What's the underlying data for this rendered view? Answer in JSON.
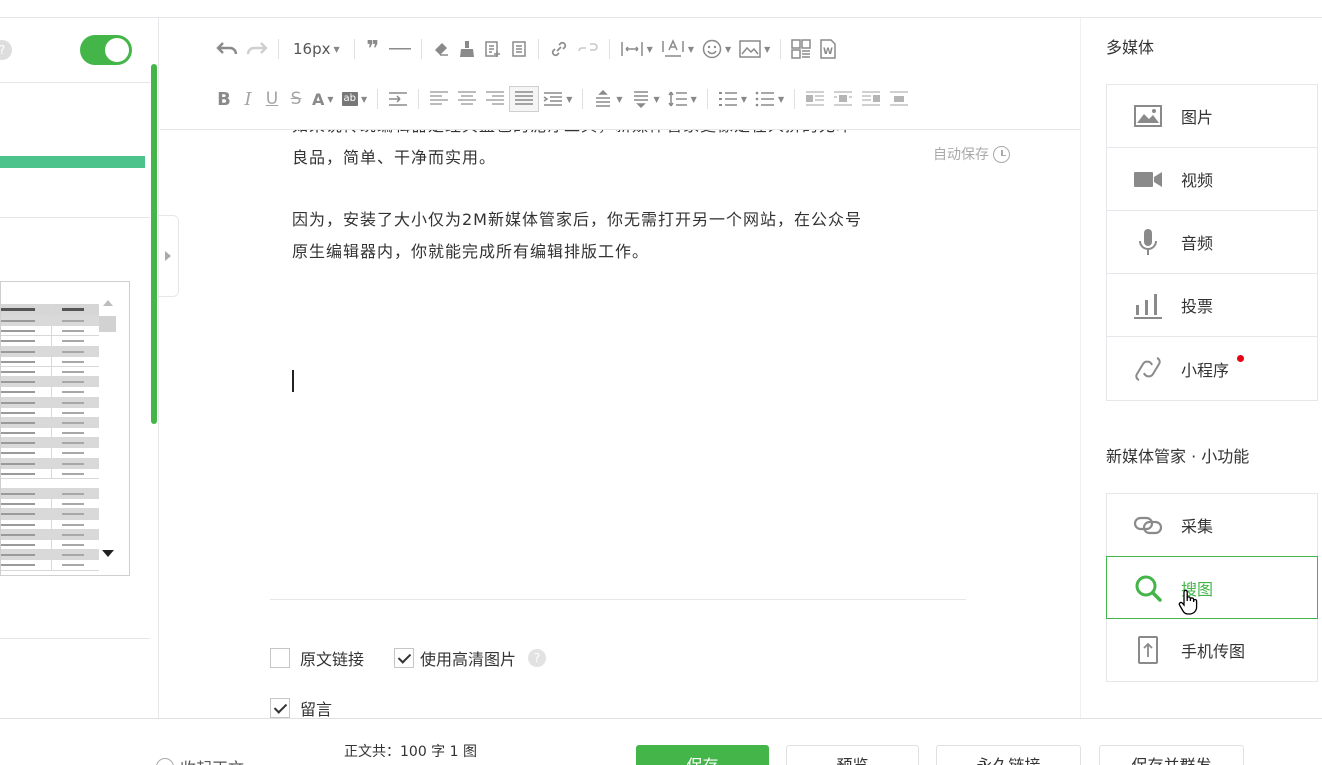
{
  "left": {
    "help": "?"
  },
  "toolbar": {
    "font_size": "16px"
  },
  "editor": {
    "autosave": "自动保存",
    "paragraphs": [
      "良品，简单、干净而实用。",
      "因为，安装了大小仅为2M新媒体管家后，你无需打开另一个网站，在公众号原生编辑器内，你就能完成所有编辑排版工作。"
    ],
    "paragraph2_line1": "因为，安装了大小仅为2M新媒体管家后，你无需打开另一个网站，在公众号",
    "paragraph2_line2": "原生编辑器内，你就能完成所有编辑排版工作。",
    "options": {
      "original_link": "原文链接",
      "hd_images": "使用高清图片",
      "hd_help": "?",
      "comments": "留言"
    }
  },
  "right_panel": {
    "media_title": "多媒体",
    "media_items": [
      {
        "label": "图片",
        "icon": "image-icon"
      },
      {
        "label": "视频",
        "icon": "video-icon"
      },
      {
        "label": "音频",
        "icon": "microphone-icon"
      },
      {
        "label": "投票",
        "icon": "bar-chart-icon"
      },
      {
        "label": "小程序",
        "icon": "mini-program-icon",
        "badge_color": "#e60012"
      }
    ],
    "tools_title": "新媒体管家 · 小功能",
    "tool_items": [
      {
        "label": "采集",
        "icon": "link-chain-icon"
      },
      {
        "label": "搜图",
        "icon": "search-icon",
        "active": true
      },
      {
        "label": "手机传图",
        "icon": "phone-upload-icon"
      }
    ]
  },
  "footer": {
    "collapse": "收起正文",
    "word_count": "正文共：100 字 1 图",
    "save": "保存",
    "preview": "预览",
    "permanent_link": "永久链接",
    "save_and_send": "保存并群发"
  },
  "colors": {
    "accent": "#44b549",
    "badge": "#e60012",
    "progress_bar": "#4cc38a"
  }
}
